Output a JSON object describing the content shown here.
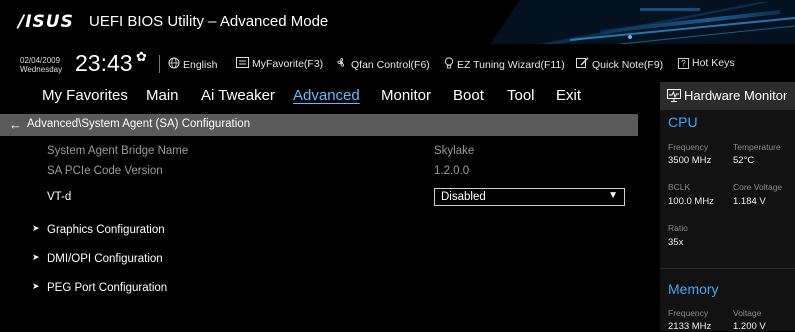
{
  "titlebar": {
    "logo": "/ISUS",
    "title": "UEFI BIOS Utility – Advanced Mode"
  },
  "toolbar": {
    "date": "02/04/2009",
    "weekday": "Wednesday",
    "time": "23:43",
    "language": "English",
    "myfavorite": "MyFavorite(F3)",
    "qfan": "Qfan Control(F6)",
    "ez_tuning": "EZ Tuning Wizard(F11)",
    "quick_note": "Quick Note(F9)",
    "hot_keys": "Hot Keys"
  },
  "tabs": [
    {
      "label": "My Favorites"
    },
    {
      "label": "Main"
    },
    {
      "label": "Ai Tweaker"
    },
    {
      "label": "Advanced"
    },
    {
      "label": "Monitor"
    },
    {
      "label": "Boot"
    },
    {
      "label": "Tool"
    },
    {
      "label": "Exit"
    }
  ],
  "active_tab": "Advanced",
  "breadcrumb": "Advanced\\System Agent (SA) Configuration",
  "content": {
    "info_rows": [
      {
        "label": "System Agent Bridge Name",
        "value": "Skylake"
      },
      {
        "label": "SA PCIe Code Version",
        "value": "1.2.0.0"
      }
    ],
    "vtd": {
      "label": "VT-d",
      "value": "Disabled"
    },
    "submenus": [
      {
        "label": "Graphics Configuration"
      },
      {
        "label": "DMI/OPI Configuration"
      },
      {
        "label": "PEG Port Configuration"
      }
    ]
  },
  "hardware_monitor": {
    "title": "Hardware Monitor",
    "cpu": {
      "heading": "CPU",
      "frequency_label": "Frequency",
      "frequency_value": "3500 MHz",
      "temperature_label": "Temperature",
      "temperature_value": "52°C",
      "bclk_label": "BCLK",
      "bclk_value": "100.0 MHz",
      "core_voltage_label": "Core Voltage",
      "core_voltage_value": "1.184 V",
      "ratio_label": "Ratio",
      "ratio_value": "35x"
    },
    "memory": {
      "heading": "Memory",
      "frequency_label": "Frequency",
      "frequency_value": "2133 MHz",
      "voltage_label": "Voltage",
      "voltage_value": "1.200 V"
    }
  },
  "colors": {
    "accent": "#62bdff",
    "hw_accent": "#3ea6ff",
    "breadcrumb_bg": "#5a5a5a",
    "panel_bg": "#121212",
    "dim_text": "#9a9a9a"
  },
  "icons": {
    "clock_settings": "gear-icon",
    "language": "globe-icon",
    "myfavorite": "favorite-list-icon",
    "qfan": "fan-icon",
    "ez_tuning": "lightbulb-icon",
    "quick_note": "note-icon",
    "hot_keys": "question-box-icon",
    "breadcrumb_back": "arrow-left-icon",
    "submenu": "chevron-right-icon",
    "dropdown": "caret-down-icon",
    "hw_monitor": "monitor-icon"
  }
}
